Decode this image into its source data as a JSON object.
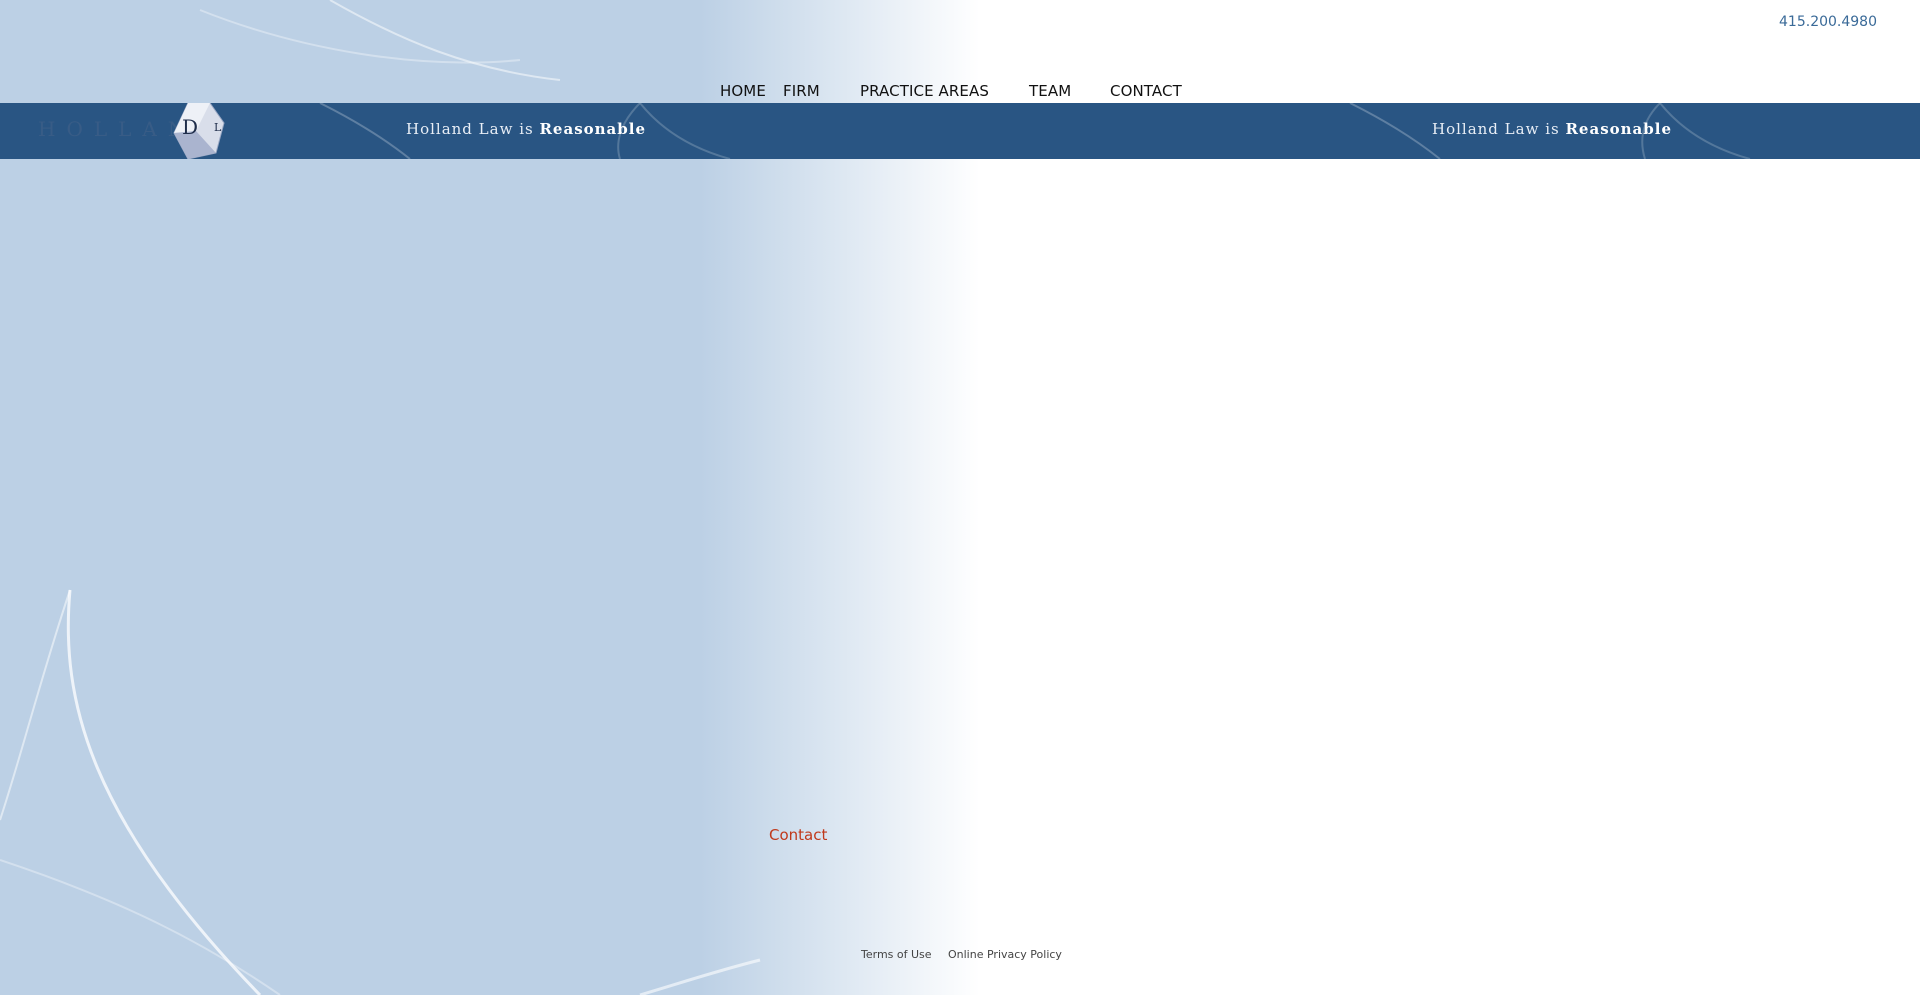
{
  "header": {
    "phone": "415.200.4980"
  },
  "nav": {
    "items": [
      {
        "label": "HOME"
      },
      {
        "label": "FIRM"
      },
      {
        "label": "PRACTICE AREAS"
      },
      {
        "label": "TEAM"
      },
      {
        "label": "CONTACT"
      }
    ]
  },
  "banner": {
    "logo_text": "HOLLAND",
    "logo_letter": "D",
    "logo_suffix": "L",
    "tagline_prefix": "Holland Law is",
    "tagline_bold": "Reasonable"
  },
  "main": {
    "contact_label": "Contact"
  },
  "footer": {
    "links": [
      {
        "label": "Terms of Use"
      },
      {
        "label": "Online Privacy Policy"
      }
    ]
  },
  "colors": {
    "banner_bg": "#295583",
    "background_blue": "#bcd0e5",
    "accent_red": "#c0391b",
    "phone_blue": "#3a6a98"
  }
}
